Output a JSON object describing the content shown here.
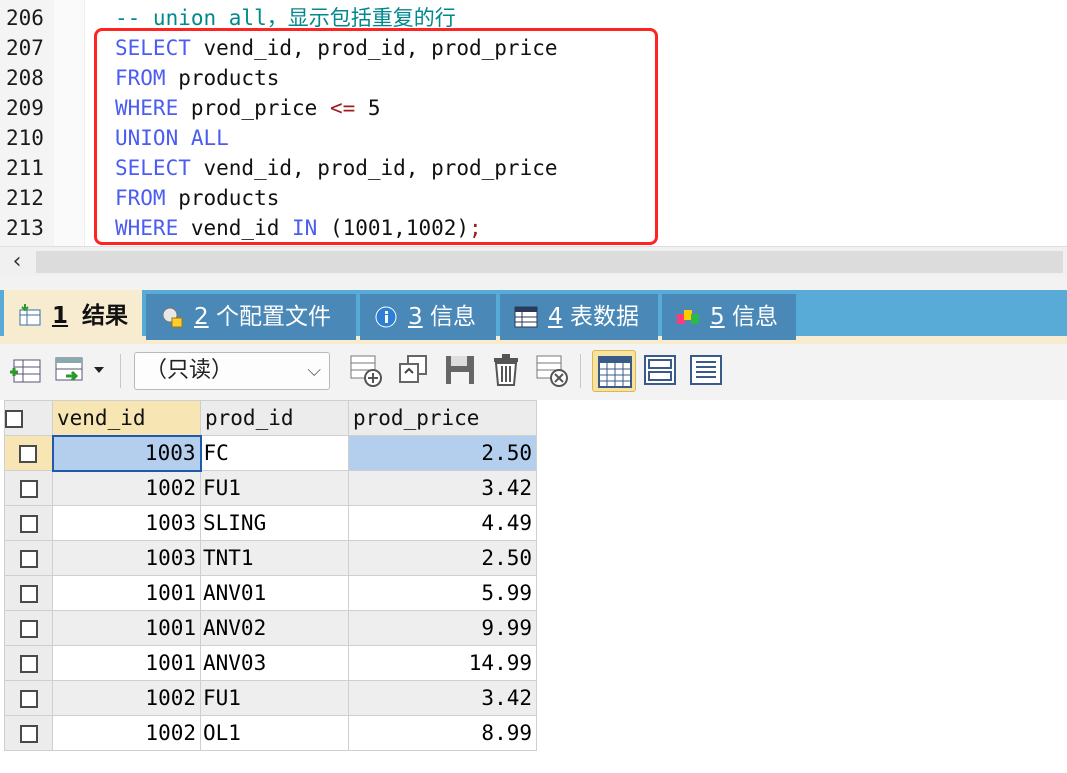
{
  "editor": {
    "lines": [
      {
        "num": "206",
        "tokens": [
          {
            "t": "-- union all，显示包括重复的行",
            "c": "cm"
          }
        ]
      },
      {
        "num": "207",
        "tokens": [
          {
            "t": "SELECT",
            "c": "kw"
          },
          {
            "t": " vend_id, prod_id, prod_price",
            "c": "nm"
          }
        ]
      },
      {
        "num": "208",
        "tokens": [
          {
            "t": "FROM",
            "c": "kw"
          },
          {
            "t": " products",
            "c": "nm"
          }
        ]
      },
      {
        "num": "209",
        "tokens": [
          {
            "t": "WHERE",
            "c": "kw"
          },
          {
            "t": " prod_price ",
            "c": "nm"
          },
          {
            "t": "<=",
            "c": "op"
          },
          {
            "t": " 5",
            "c": "nm"
          }
        ]
      },
      {
        "num": "210",
        "tokens": [
          {
            "t": "UNION ALL",
            "c": "kw"
          }
        ]
      },
      {
        "num": "211",
        "tokens": [
          {
            "t": "SELECT",
            "c": "kw"
          },
          {
            "t": " vend_id, prod_id, prod_price",
            "c": "nm"
          }
        ]
      },
      {
        "num": "212",
        "tokens": [
          {
            "t": "FROM",
            "c": "kw"
          },
          {
            "t": " products",
            "c": "nm"
          }
        ]
      },
      {
        "num": "213",
        "tokens": [
          {
            "t": "WHERE",
            "c": "kw"
          },
          {
            "t": " vend_id ",
            "c": "nm"
          },
          {
            "t": "IN",
            "c": "kw"
          },
          {
            "t": " (1001,1002)",
            "c": "nm"
          },
          {
            "t": ";",
            "c": "op"
          }
        ]
      }
    ]
  },
  "tabs": [
    {
      "num": "1",
      "label": "结果",
      "icon": "result-icon",
      "active": true
    },
    {
      "num": "2",
      "label": "个配置文件",
      "icon": "profile-icon",
      "active": false
    },
    {
      "num": "3",
      "label": "信息",
      "icon": "info-icon",
      "active": false
    },
    {
      "num": "4",
      "label": "表数据",
      "icon": "table-data-icon",
      "active": false
    },
    {
      "num": "5",
      "label": "信息",
      "icon": "info-blocks-icon",
      "active": false
    }
  ],
  "toolbar": {
    "mode_select": "（只读）"
  },
  "grid": {
    "columns": [
      "vend_id",
      "prod_id",
      "prod_price"
    ],
    "rows": [
      [
        "1003",
        "FC",
        "2.50"
      ],
      [
        "1002",
        "FU1",
        "3.42"
      ],
      [
        "1003",
        "SLING",
        "4.49"
      ],
      [
        "1003",
        "TNT1",
        "2.50"
      ],
      [
        "1001",
        "ANV01",
        "5.99"
      ],
      [
        "1001",
        "ANV02",
        "9.99"
      ],
      [
        "1001",
        "ANV03",
        "14.99"
      ],
      [
        "1002",
        "FU1",
        "3.42"
      ],
      [
        "1002",
        "OL1",
        "8.99"
      ]
    ],
    "selected_row": 0
  },
  "colors": {
    "keyword": "#4b5cf0",
    "comment": "#00888f",
    "operator": "#9b1c1c",
    "highlight_box": "#ff2424",
    "tabbar": "#58aad7",
    "active_tab": "#f7ecd0"
  }
}
